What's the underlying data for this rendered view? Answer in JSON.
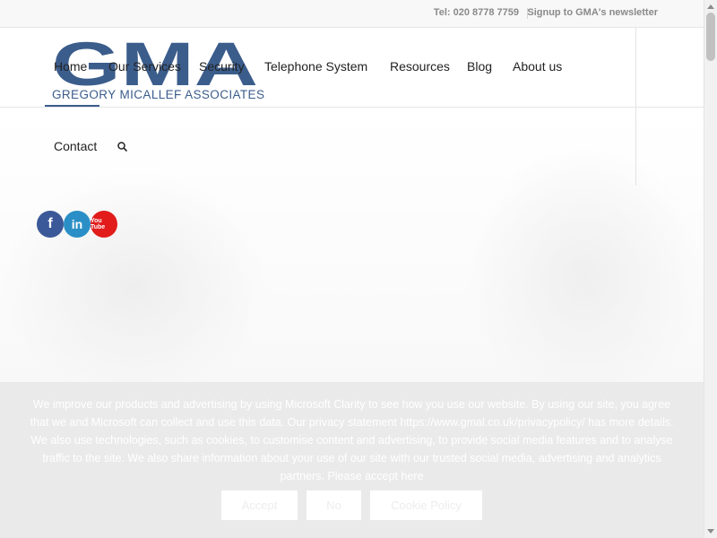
{
  "topbar": {
    "tel": "Tel: 020 8778 7759",
    "newsletter": "Signup to GMA's newsletter"
  },
  "logo": {
    "letters": "GMA",
    "subtitle": "GREGORY MICALLEF ASSOCIATES",
    "color": "#3b5d8c"
  },
  "nav": {
    "home": "Home",
    "services": "Our Services",
    "security": "Security",
    "telephone": "Telephone System",
    "resources": "Resources",
    "blog": "Blog",
    "about": "About us",
    "contact": "Contact"
  },
  "social": {
    "facebook": "f",
    "linkedin": "in",
    "youtube": "You Tube"
  },
  "cookie": {
    "message": "We improve our products and advertising by using Microsoft Clarity to see how you use our website. By using our site, you agree that we and Microsoft can collect and use this data. Our privacy statement https://www.gmal.co.uk/privacypolicy/ has more details. We also use technologies, such as cookies, to customise content and advertising, to provide social media features and to analyse traffic to the site. We also share information about your use of our site with our trusted social media, advertising and analytics partners. Please accept here",
    "accept": "Accept",
    "no": "No",
    "policy": "Cookie Policy"
  }
}
